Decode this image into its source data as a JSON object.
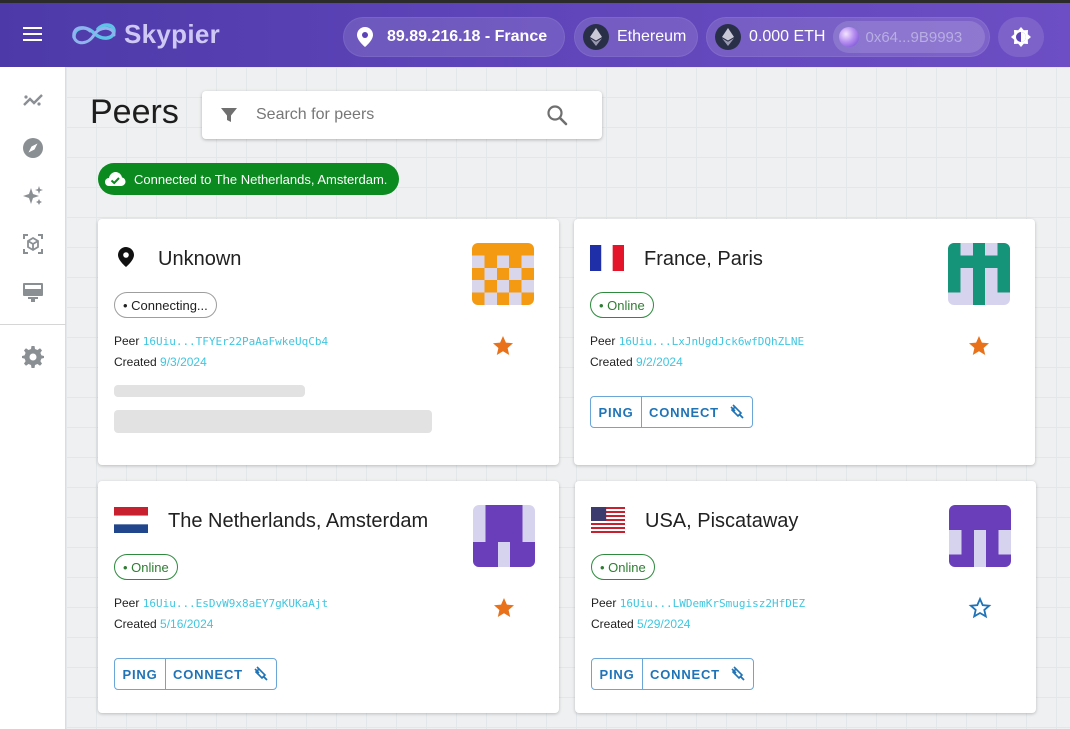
{
  "header": {
    "app_name": "Skypier",
    "location": "89.89.216.18 - France",
    "network": "Ethereum",
    "balance": "0.000 ETH",
    "address": "0x64...9B9993"
  },
  "sidebar": {
    "items": [
      {
        "icon": "analytics-icon"
      },
      {
        "icon": "explore-icon"
      },
      {
        "icon": "sparkle-icon"
      },
      {
        "icon": "view-in-ar-icon"
      },
      {
        "icon": "dashboard-icon"
      },
      {
        "icon": "settings-icon"
      }
    ]
  },
  "main": {
    "title": "Peers",
    "search": {
      "placeholder": "Search for peers",
      "value": ""
    },
    "status": "Connected to The Netherlands, Amsterdam.",
    "cards": [
      {
        "title": "Unknown",
        "status": "• Connecting...",
        "peer_label": "Peer",
        "peer_id": "16Uiu...TFYEr22PaAaFwkeUqCb4",
        "created_label": "Created",
        "created": "9/3/2024",
        "favorite": true
      },
      {
        "title": "France, Paris",
        "status": "• Online",
        "peer_label": "Peer",
        "peer_id": "16Uiu...LxJnUgdJck6wfDQhZLNE",
        "created_label": "Created",
        "created": "9/2/2024",
        "favorite": true,
        "ping_label": "PING",
        "connect_label": "CONNECT"
      },
      {
        "title": "The Netherlands, Amsterdam",
        "status": "• Online",
        "peer_label": "Peer",
        "peer_id": "16Uiu...EsDvW9x8aEY7gKUKaAjt",
        "created_label": "Created",
        "created": "5/16/2024",
        "favorite": true,
        "ping_label": "PING",
        "connect_label": "CONNECT"
      },
      {
        "title": "USA, Piscataway",
        "status": "• Online",
        "peer_label": "Peer",
        "peer_id": "16Uiu...LWDemKrSmugisz2HfDEZ",
        "created_label": "Created",
        "created": "5/29/2024",
        "favorite": false,
        "ping_label": "PING",
        "connect_label": "CONNECT"
      }
    ]
  },
  "colors": {
    "header": "#5c43b7",
    "status_green": "#0a8a1f",
    "link": "#3fc6e0",
    "button": "#1f73b7",
    "star": "#e8711a"
  }
}
